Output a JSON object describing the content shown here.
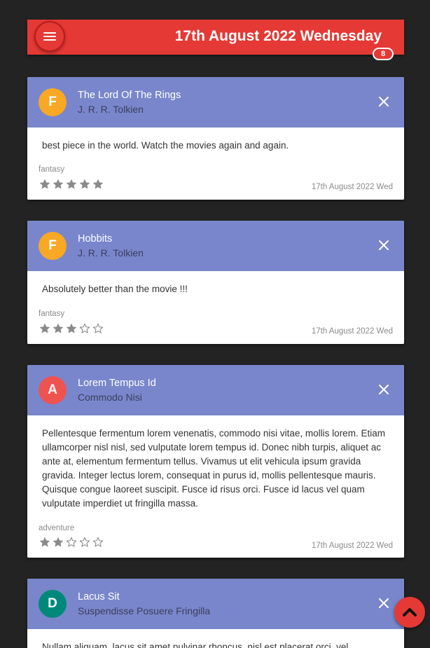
{
  "header": {
    "title": "17th August 2022 Wednesday",
    "count_badge": "8",
    "menu_icon": "hamburger-menu-icon"
  },
  "colors": {
    "header_bg": "#e53935",
    "card_header_bg": "#7986cb",
    "page_bg": "#232323",
    "star_color": "#8a8a8a"
  },
  "cards": [
    {
      "initial": "F",
      "avatar_color": "#f9a825",
      "title": "The Lord Of The Rings",
      "author": "J. R. R. Tolkien",
      "review": "best piece in the world. Watch the movies again and again.",
      "genre": "fantasy",
      "rating": 5,
      "max_rating": 5,
      "date": "17th August 2022 Wed"
    },
    {
      "initial": "F",
      "avatar_color": "#f9a825",
      "title": "Hobbits",
      "author": "J. R. R. Tolkien",
      "review": "Absolutely better than the movie !!!",
      "genre": "fantasy",
      "rating": 3,
      "max_rating": 5,
      "date": "17th August 2022 Wed"
    },
    {
      "initial": "A",
      "avatar_color": "#ef5350",
      "title": "Lorem Tempus Id",
      "author": "Commodo Nisi",
      "review": "Pellentesque fermentum lorem venenatis, commodo nisi vitae, mollis lorem. Etiam ullamcorper nisl nisl, sed vulputate lorem tempus id. Donec nibh turpis, aliquet ac ante at, elementum fermentum tellus. Vivamus ut elit vehicula ipsum gravida gravida. Integer lectus lorem, consequat in purus id, mollis pellentesque mauris. Quisque congue laoreet suscipit. Fusce id risus orci. Fusce id lacus vel quam vulputate imperdiet ut fringilla massa.",
      "genre": "adventure",
      "rating": 2,
      "max_rating": 5,
      "date": "17th August 2022 Wed"
    },
    {
      "initial": "D",
      "avatar_color": "#00897b",
      "title": "Lacus Sit",
      "author": "Suspendisse Posuere Fringilla",
      "review": "Nullam aliquam, lacus sit amet pulvinar rhoncus, nisl est placerat orci, vel",
      "genre": "",
      "rating": 0,
      "max_rating": 5,
      "date": ""
    }
  ],
  "scroll_top_icon": "chevron-up-icon"
}
